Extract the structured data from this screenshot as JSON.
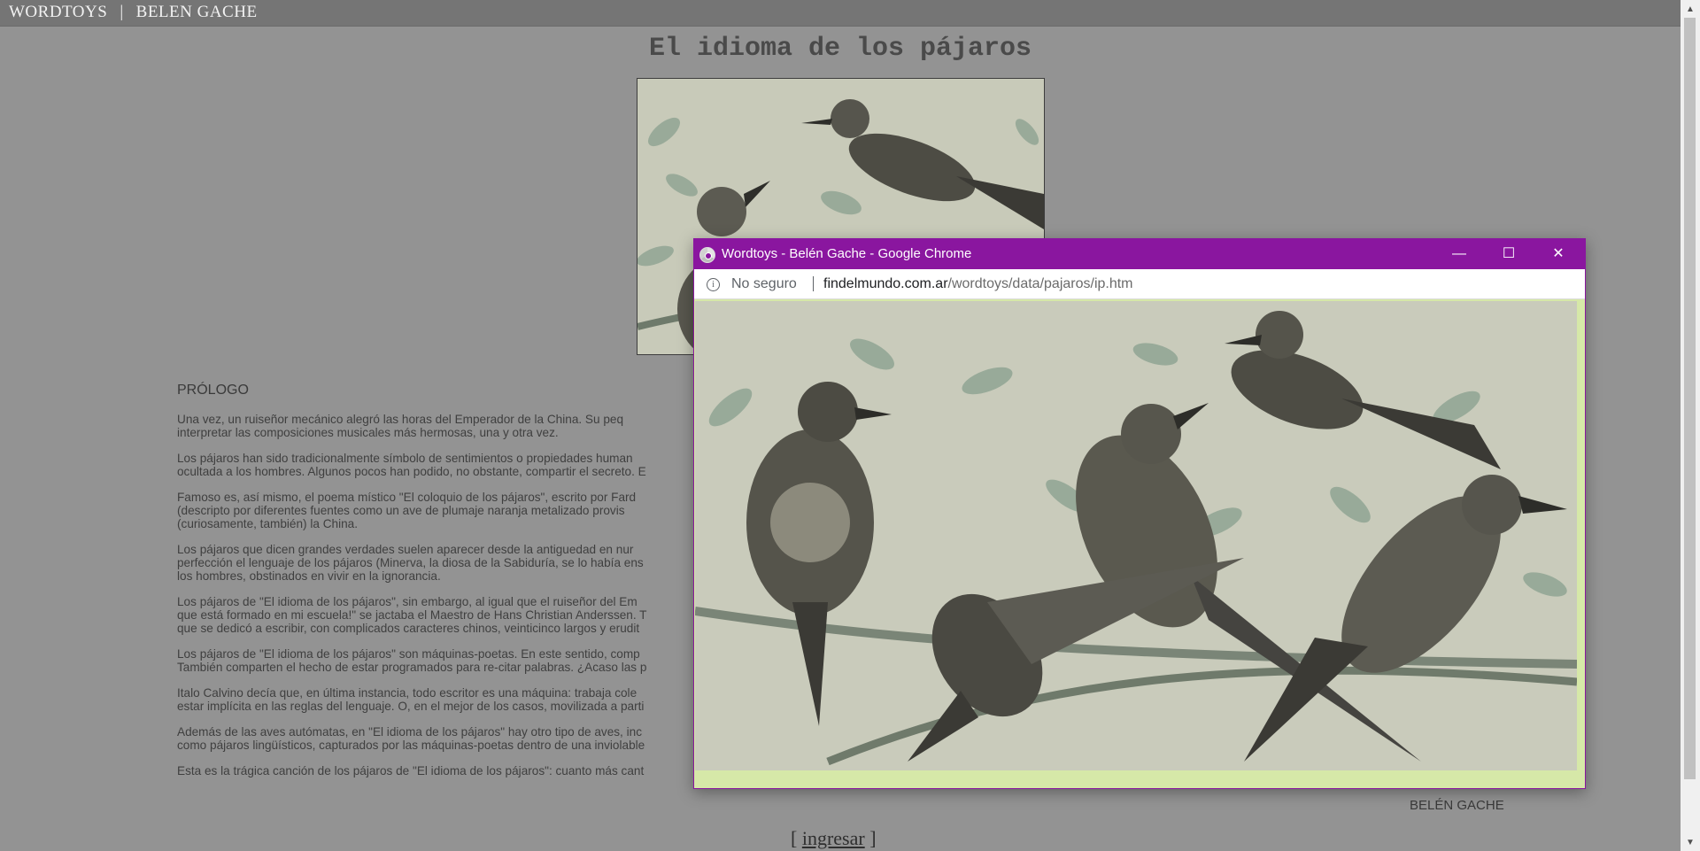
{
  "header": {
    "site": "WORDTOYS",
    "separator": "|",
    "author": "BELEN GACHE"
  },
  "page": {
    "title": "El idioma de los pájaros",
    "section_title": "PRÓLOGO",
    "paragraphs": [
      [
        "Una vez, un ruiseñor mecánico alegró las horas del Emperador de la China. Su peq",
        "interpretar las composiciones musicales más hermosas, una y otra vez."
      ],
      [
        "Los pájaros han sido tradicionalmente símbolo de sentimientos o propiedades human",
        "ocultada a los hombres. Algunos pocos han podido, no obstante, compartir el secreto. E"
      ],
      [
        "Famoso es, así mismo, el poema místico \"El coloquio de los pájaros\", escrito por Fard",
        "(descripto por diferentes fuentes como un ave de plumaje naranja metalizado provis",
        "(curiosamente, también) la China."
      ],
      [
        "Los pájaros que dicen grandes verdades suelen aparecer desde la antiguedad en nur",
        "perfección el lenguaje de los pájaros (Minerva, la diosa de la Sabiduría, se lo había ens",
        "los hombres, obstinados en vivir en la ignorancia."
      ],
      [
        "Los pájaros de \"El idioma de los pájaros\", sin embargo, al igual que el ruiseñor del Em",
        "que está formado en mi escuela!\" se jactaba el Maestro de Hans Christian Anderssen. T",
        "que se dedicó a escribir, con complicados caracteres chinos, veinticinco largos y erudit"
      ],
      [
        "Los pájaros de \"El idioma de los pájaros\" son máquinas-poetas. En este sentido, comp",
        "También comparten el hecho de estar programados para re-citar palabras. ¿Acaso las p"
      ],
      [
        "Italo Calvino decía que, en última instancia, todo escritor es una máquina: trabaja cole",
        "estar implícita en las reglas del lenguaje. O, en el mejor de los casos, movilizada a parti"
      ],
      [
        "Además de las aves autómatas, en \"El idioma de los pájaros\" hay otro tipo de aves, inc",
        "como pájaros lingüísticos, capturados por las máquinas-poetas dentro de una inviolable"
      ],
      [
        "Esta es la trágica canción de los pájaros de \"El idioma de los pájaros\": cuanto más cant"
      ]
    ],
    "author_sign": "BELÉN GACHE",
    "enter_open": "[",
    "enter_link": "ingresar",
    "enter_close": "]"
  },
  "popup": {
    "title": "Wordtoys - Belén Gache - Google Chrome",
    "minimize": "—",
    "maximize": "☐",
    "close": "✕",
    "security": "No seguro",
    "url_domain": "findelmundo.com.ar",
    "url_path": "/wordtoys/data/pajaros/ip.htm",
    "accent_color": "#8a169f",
    "icon": "chrome-icon"
  }
}
